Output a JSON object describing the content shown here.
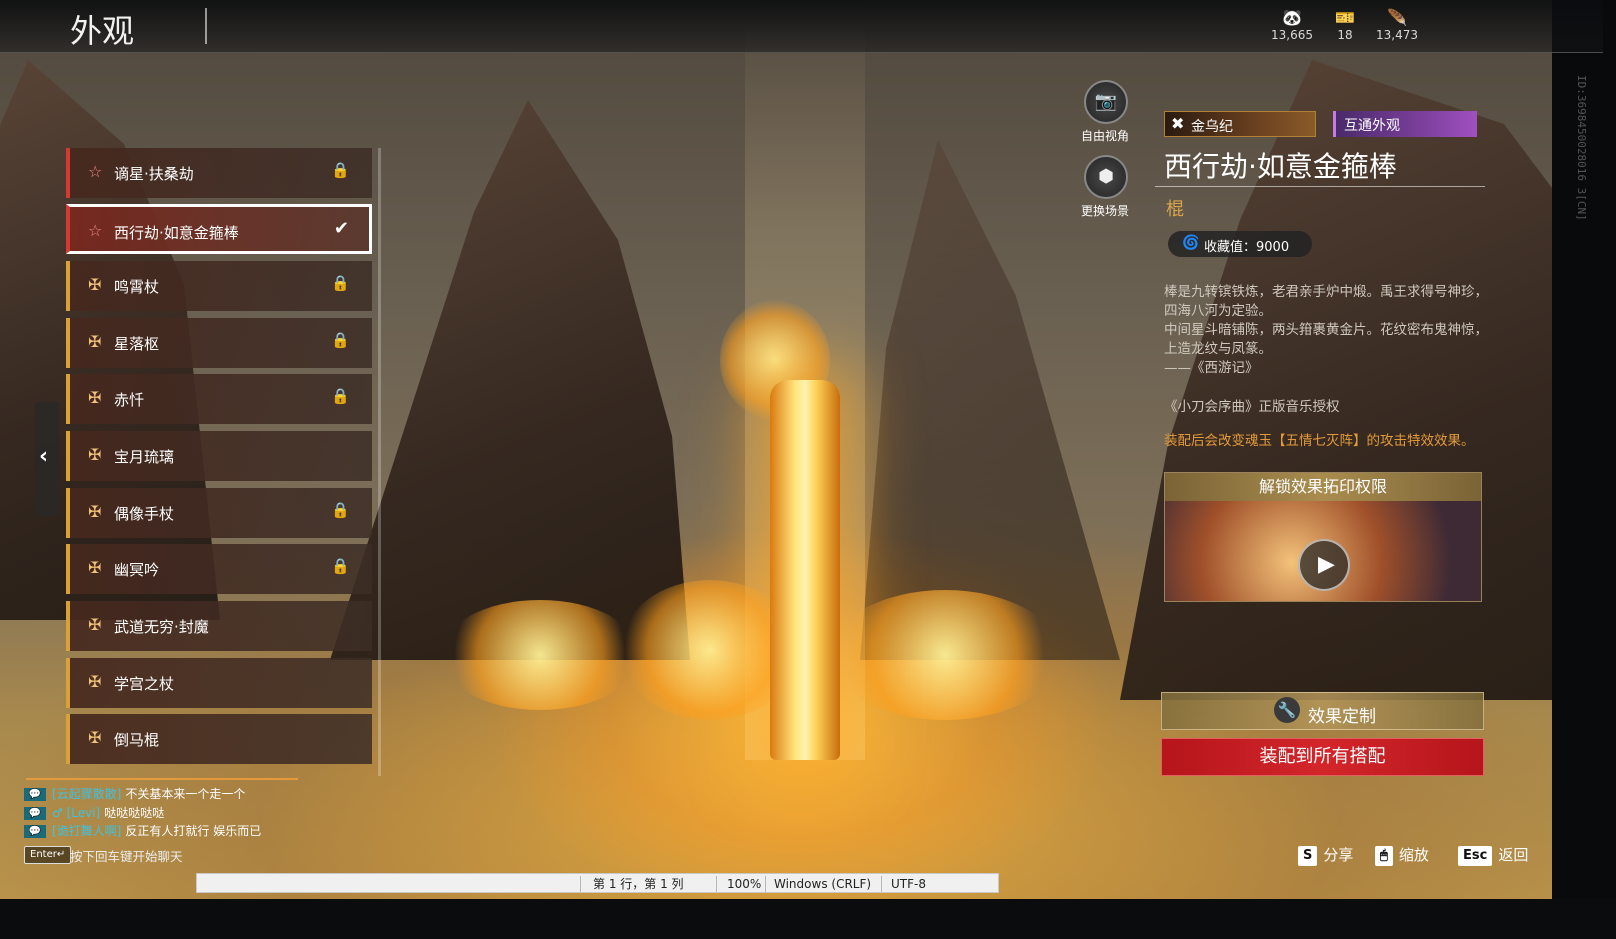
{
  "header": {
    "title": "外观"
  },
  "currencies": [
    {
      "icon": "mask-coin-icon",
      "glyph": "🐼",
      "value": "13,665"
    },
    {
      "icon": "ticket-icon",
      "glyph": "🎫",
      "value": "18"
    },
    {
      "icon": "feather-icon",
      "glyph": "🪶",
      "value": "13,473"
    }
  ],
  "vertical_id": "ID:3698450028016 3[CN]",
  "list": {
    "items": [
      {
        "label": "谪星·扶桑劫",
        "icon": "star-outline-icon",
        "glyph": "☆",
        "state": "locked",
        "accent": "red"
      },
      {
        "label": "西行劫·如意金箍棒",
        "icon": "star-outline-icon",
        "glyph": "☆",
        "state": "equipped",
        "accent": "red"
      },
      {
        "label": "鸣霄杖",
        "icon": "cross-emblem-icon",
        "glyph": "✠",
        "state": "locked",
        "accent": "gold"
      },
      {
        "label": "星落枢",
        "icon": "cross-emblem-icon",
        "glyph": "✠",
        "state": "locked",
        "accent": "gold"
      },
      {
        "label": "赤忏",
        "icon": "cross-emblem-icon",
        "glyph": "✠",
        "state": "locked",
        "accent": "gold"
      },
      {
        "label": "宝月琉璃",
        "icon": "cross-emblem-icon",
        "glyph": "✠",
        "state": "",
        "accent": "gold"
      },
      {
        "label": "偶像手杖",
        "icon": "cross-emblem-icon",
        "glyph": "✠",
        "state": "locked",
        "accent": "gold"
      },
      {
        "label": "幽冥吟",
        "icon": "cross-emblem-icon",
        "glyph": "✠",
        "state": "locked",
        "accent": "gold"
      },
      {
        "label": "武道无穷·封魔",
        "icon": "cross-emblem-icon",
        "glyph": "✠",
        "state": "",
        "accent": "gold"
      },
      {
        "label": "学宫之杖",
        "icon": "cross-emblem-icon",
        "glyph": "✠",
        "state": "",
        "accent": "gold"
      },
      {
        "label": "倒马棍",
        "icon": "cross-emblem-icon",
        "glyph": "✠",
        "state": "",
        "accent": "gold"
      }
    ]
  },
  "camera": {
    "free_view": "自由视角",
    "change_scene": "更换场景"
  },
  "detail": {
    "series_tag": "金乌纪",
    "shared_tag": "互通外观",
    "name": "西行劫·如意金箍棒",
    "type": "棍",
    "collect_label": "收藏值：9000",
    "description": [
      "棒是九转镔铁炼，老君亲手炉中煅。禹王求得号神珍，四海八河为定验。",
      "中间星斗暗铺陈，两头箝裹黄金片。花纹密布鬼神惊，上造龙纹与凤篆。",
      "——《西游记》"
    ],
    "music_note": "《小刀会序曲》正版音乐授权",
    "effect_note": "装配后会改变魂玉【五情七灭阵】的攻击特效效果。",
    "video_title": "解锁效果拓印权限",
    "custom_button": "效果定制",
    "equip_button": "装配到所有搭配"
  },
  "chat": {
    "lines": [
      {
        "channel": "💬",
        "name": "[云起骤散散]",
        "text": "不关基本来一个走一个"
      },
      {
        "channel": "💬",
        "name": "♂ [Levi]",
        "text": "哒哒哒哒哒"
      },
      {
        "channel": "💬",
        "name": "[诡打舞人啊]",
        "text": "反正有人打就行 娱乐而已"
      }
    ],
    "enter_key": "Enter↵",
    "enter_hint": "按下回车键开始聊天"
  },
  "hints": {
    "share_key": "S",
    "share_label": "分享",
    "zoom_key": "🖱",
    "zoom_label": "缩放",
    "back_key": "Esc",
    "back_label": "返回"
  },
  "statusbar": {
    "position": "第 1 行，第 1 列",
    "zoom": "100%",
    "line_ending": "Windows (CRLF)",
    "encoding": "UTF-8"
  }
}
